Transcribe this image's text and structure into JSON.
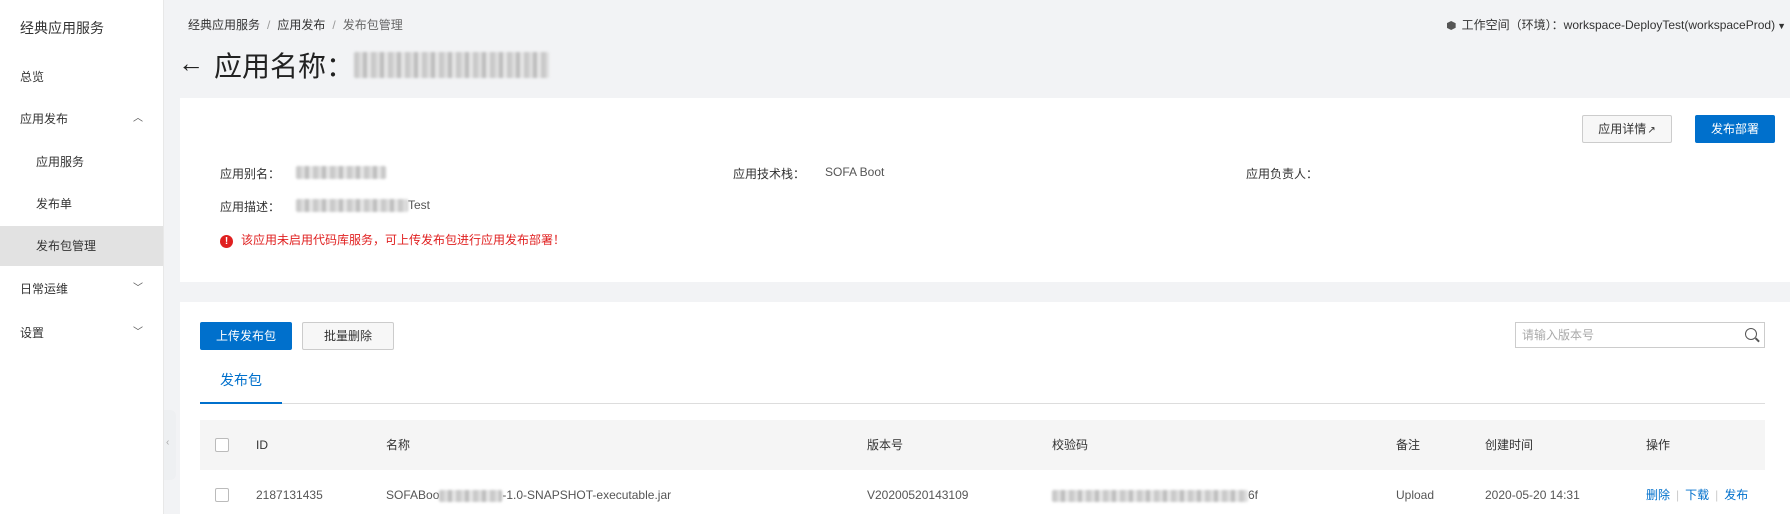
{
  "sidebar": {
    "title": "经典应用服务",
    "items": [
      {
        "label": "总览"
      },
      {
        "label": "应用发布",
        "expanded": true
      },
      {
        "label": "应用服务"
      },
      {
        "label": "发布单"
      },
      {
        "label": "发布包管理",
        "active": true
      },
      {
        "label": "日常运维"
      },
      {
        "label": "设置"
      }
    ]
  },
  "header": {
    "breadcrumb": [
      "经典应用服务",
      "应用发布",
      "发布包管理"
    ],
    "breadcrumb_sep": "/",
    "workspace": "工作空间（环境）：workspace-DeployTest(workspaceProd)",
    "back_icon": "←",
    "title_prefix": "应用名称："
  },
  "info": {
    "detail_button": "应用详情",
    "deploy_button": "发布部署",
    "alias_label": "应用别名：",
    "tech_label": "应用技术栈：",
    "tech_value": "SOFA Boot",
    "owner_label": "应用负责人：",
    "desc_label": "应用描述：",
    "desc_suffix": "Test",
    "warning": "该应用未启用代码库服务，可上传发布包进行应用发布部署！"
  },
  "packages": {
    "upload_button": "上传发布包",
    "batch_delete_button": "批量删除",
    "search_placeholder": "请输入版本号",
    "tab": "发布包",
    "columns": {
      "id": "ID",
      "name": "名称",
      "version": "版本号",
      "checksum": "校验码",
      "remark": "备注",
      "created": "创建时间",
      "actions": "操作"
    },
    "rows": [
      {
        "id": "2187131435",
        "name_prefix": "SOFABoo",
        "name_suffix": "-1.0-SNAPSHOT-executable.jar",
        "version": "V20200520143109",
        "checksum_suffix": "6f",
        "remark": "Upload",
        "created": "2020-05-20 14:31",
        "action_delete": "删除",
        "action_download": "下载",
        "action_publish": "发布"
      }
    ]
  },
  "colors": {
    "primary": "#0070cc",
    "warning": "#e02020",
    "sidebar_active": "#e2e2e2"
  }
}
